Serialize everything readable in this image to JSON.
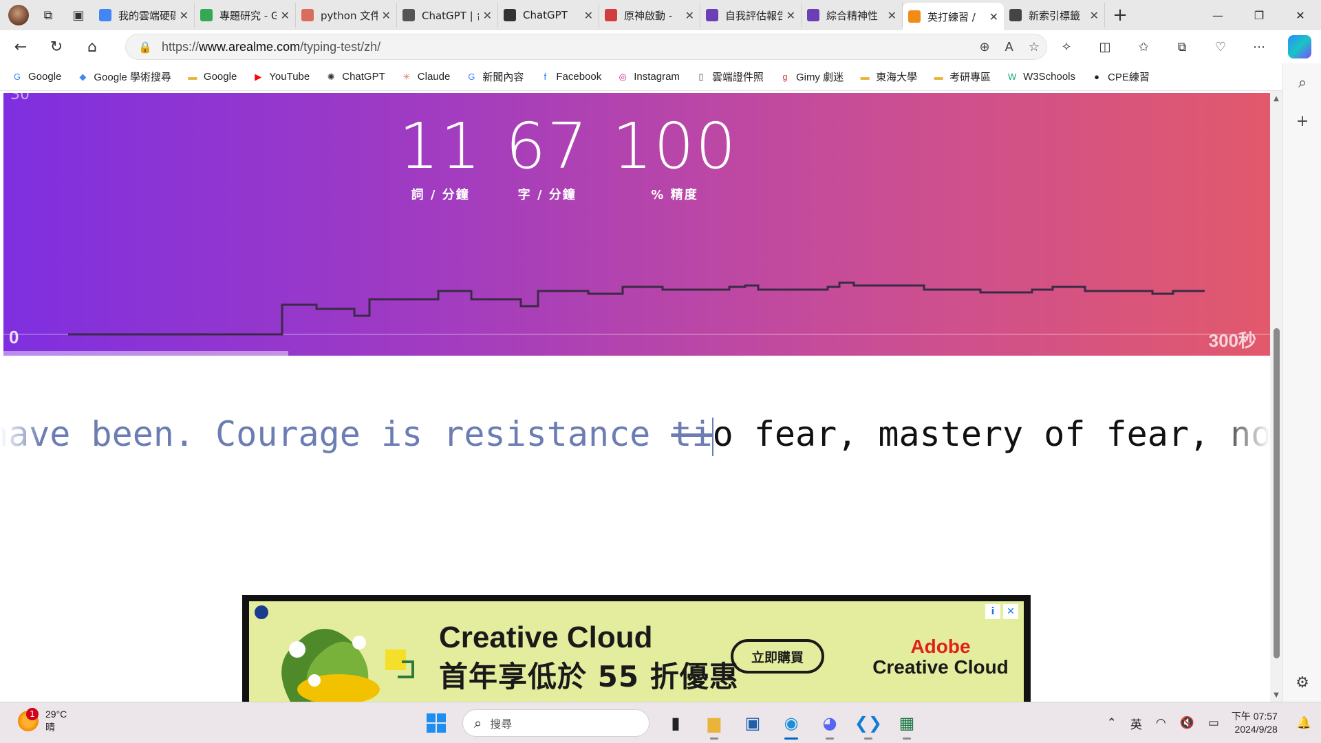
{
  "browser": {
    "tabs": [
      {
        "label": "我的雲端硬碟",
        "color": "#4285f4"
      },
      {
        "label": "專題研究 - Google",
        "color": "#34a853"
      },
      {
        "label": "python 文件",
        "color": "#d96c5a"
      },
      {
        "label": "ChatGPT | 台",
        "color": "#555555"
      },
      {
        "label": "ChatGPT",
        "color": "#333333"
      },
      {
        "label": "原神啟動 - ",
        "color": "#d23c3c"
      },
      {
        "label": "自我評估報告",
        "color": "#6c3fb5"
      },
      {
        "label": "綜合精神性",
        "color": "#6c3fb5"
      },
      {
        "label": "英打練習 / ",
        "color": "#f28c18",
        "active": true
      },
      {
        "label": "新索引標籤",
        "color": "#444444"
      }
    ],
    "url_prefix": "https://",
    "url_domain": "www.arealme.com",
    "url_path": "/typing-test/zh/"
  },
  "bookmarks": [
    {
      "label": "Google",
      "icon": "G",
      "color": "#4285f4"
    },
    {
      "label": "Google 學術搜尋",
      "icon": "◆",
      "color": "#4285f4"
    },
    {
      "label": "Google",
      "icon": "▬",
      "color": "#e8b43a"
    },
    {
      "label": "YouTube",
      "icon": "▶",
      "color": "#ff0000"
    },
    {
      "label": "ChatGPT",
      "icon": "✺",
      "color": "#333333"
    },
    {
      "label": "Claude",
      "icon": "✳",
      "color": "#d97757"
    },
    {
      "label": "新聞內容",
      "icon": "G",
      "color": "#4285f4"
    },
    {
      "label": "Facebook",
      "icon": "f",
      "color": "#1877f2"
    },
    {
      "label": "Instagram",
      "icon": "◎",
      "color": "#d6249f"
    },
    {
      "label": "雲端證件照",
      "icon": "▯",
      "color": "#555555"
    },
    {
      "label": "Gimy 劇迷",
      "icon": "g",
      "color": "#d23c3c"
    },
    {
      "label": "東海大學",
      "icon": "▬",
      "color": "#e8b43a"
    },
    {
      "label": "考研專區",
      "icon": "▬",
      "color": "#e8b43a"
    },
    {
      "label": "W3Schools",
      "icon": "W",
      "color": "#04aa6d"
    },
    {
      "label": "CPE練習",
      "icon": "●",
      "color": "#222222"
    }
  ],
  "typing_test": {
    "corner_fragment": "30",
    "wpm": "11",
    "wpm_label": "詞 / 分鐘",
    "cpm": "67",
    "cpm_label": "字 / 分鐘",
    "accuracy": "100",
    "accuracy_label": "% 精度",
    "axis_start": "0",
    "axis_end": "300秒",
    "elapsed_fraction": 0.225,
    "typed_text": "have been. Courage is resistance ",
    "wrong_text": "ti",
    "pending_text": "o fear, mastery of fear, not absence"
  },
  "ad": {
    "headline1": "Creative Cloud",
    "headline2": "首年享低於 55 折優惠",
    "button": "立即購買",
    "brand1": "Adobe",
    "brand2": "Creative Cloud"
  },
  "taskbar": {
    "weather_temp": "29°C",
    "weather_desc": "晴",
    "weather_badge": "1",
    "search_placeholder": "搜尋",
    "ime": "英",
    "time": "下午 07:57",
    "date": "2024/9/28"
  }
}
